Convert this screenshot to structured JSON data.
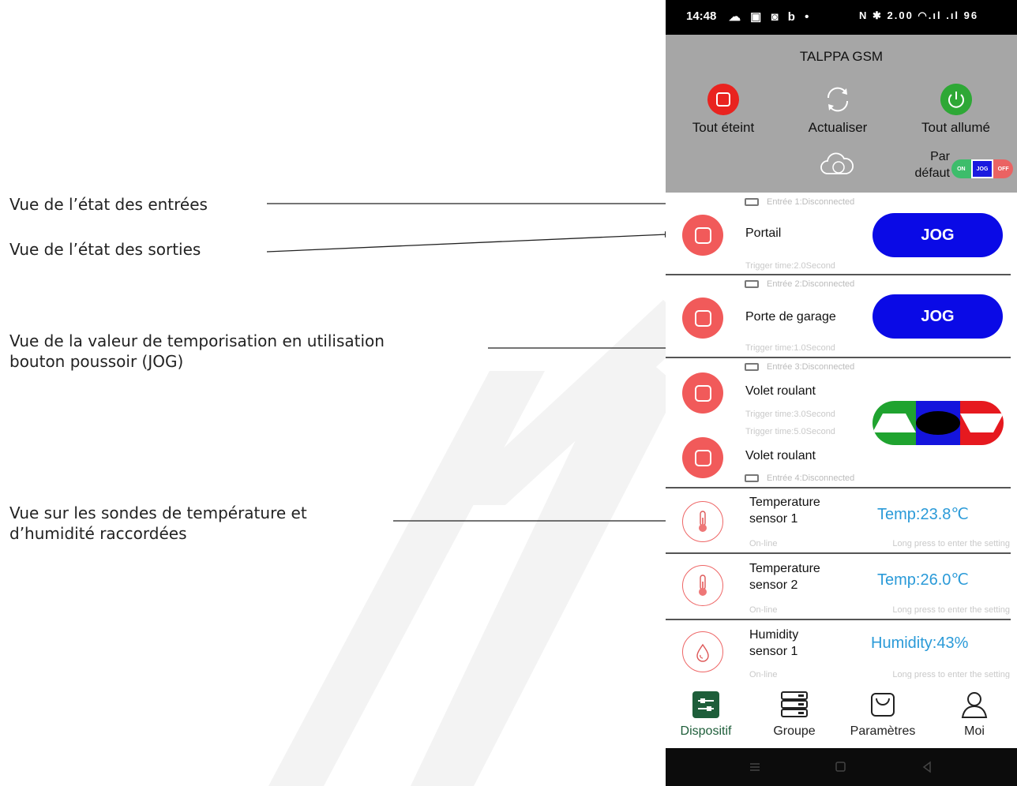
{
  "annotations": {
    "inputs": "Vue de l’état des entrées",
    "outputs": "Vue de l’état des sorties",
    "timer_line1": "Vue de la valeur de temporisation en utilisation",
    "timer_line2": "bouton poussoir (JOG)",
    "sensors_line1": "Vue sur les sondes de température et",
    "sensors_line2": "d’humidité raccordées"
  },
  "statusbar": {
    "time": "14:48",
    "left_icons": "☁ ▣ ◙ b •",
    "right_icons": "N ✱ 2.00 ◠.ıl .ıl 96"
  },
  "header": {
    "title": "TALPPA GSM",
    "all_off": "Tout éteint",
    "refresh": "Actualiser",
    "all_on": "Tout allumé",
    "default_line1": "Par",
    "default_line2": "défaut",
    "mode_on": "ON",
    "mode_jog": "JOG",
    "mode_off": "OFF"
  },
  "outputs": [
    {
      "input_label": "Entrée 1:Disconnected",
      "name": "Portail",
      "trigger": "Trigger time:2.0Second",
      "button": "JOG"
    },
    {
      "input_label": "Entrée 2:Disconnected",
      "name": "Porte de garage",
      "trigger": "Trigger time:1.0Second",
      "button": "JOG"
    },
    {
      "input_label": "Entrée 3:Disconnected",
      "name": "Volet roulant",
      "trigger": "Trigger time:3.0Second"
    },
    {
      "input_label": "Entrée 4:Disconnected",
      "name": "Volet roulant",
      "trigger": "Trigger time:5.0Second"
    }
  ],
  "sensors": [
    {
      "name1": "Temperature",
      "name2": "sensor 1",
      "value": "Temp:23.8℃",
      "status": "On-line",
      "hint": "Long press to enter the setting",
      "icon": "thermometer-icon"
    },
    {
      "name1": "Temperature",
      "name2": "sensor 2",
      "value": "Temp:26.0℃",
      "status": "On-line",
      "hint": "Long press to enter the setting",
      "icon": "thermometer-icon"
    },
    {
      "name1": "Humidity",
      "name2": "sensor 1",
      "value": "Humidity:43%",
      "status": "On-line",
      "hint": "Long press to enter the setting",
      "icon": "droplet-icon"
    }
  ],
  "bottomnav": {
    "device": "Dispositif",
    "group": "Groupe",
    "settings": "Paramètres",
    "me": "Moi"
  },
  "colors": {
    "accent_red": "#f15a5a",
    "jog_blue": "#0a0ae6",
    "sensor_blue": "#2a9ad8",
    "active_green": "#1e5e3a"
  }
}
